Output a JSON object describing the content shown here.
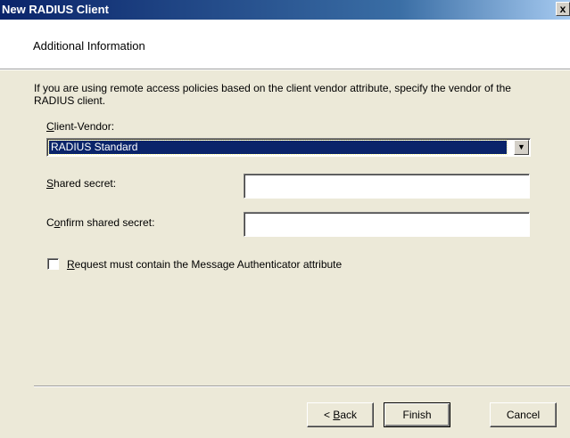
{
  "window": {
    "title": "New RADIUS Client",
    "close_glyph": "x"
  },
  "header": {
    "title": "Additional Information"
  },
  "description": "If you are using remote access policies based on the client vendor attribute, specify the vendor of the RADIUS client.",
  "client_vendor": {
    "label_mnemonic": "C",
    "label_rest": "lient-Vendor:",
    "selected_value": "RADIUS Standard",
    "arrow_icon": "chevron-down-icon"
  },
  "shared_secret": {
    "label_mnemonic": "S",
    "label_rest": "hared secret:",
    "value": ""
  },
  "confirm_secret": {
    "label_pre": "C",
    "label_mnemonic": "o",
    "label_rest": "nfirm shared secret:",
    "value": ""
  },
  "message_authenticator": {
    "label_mnemonic": "R",
    "label_rest": "equest must contain the Message Authenticator attribute",
    "checked": false
  },
  "buttons": {
    "back_prefix": "< ",
    "back_mnemonic": "B",
    "back_rest": "ack",
    "finish": "Finish",
    "cancel": "Cancel"
  },
  "colors": {
    "titlebar_start": "#0a246a",
    "selection": "#0a246a",
    "dialog_bg": "#ece9d8"
  }
}
